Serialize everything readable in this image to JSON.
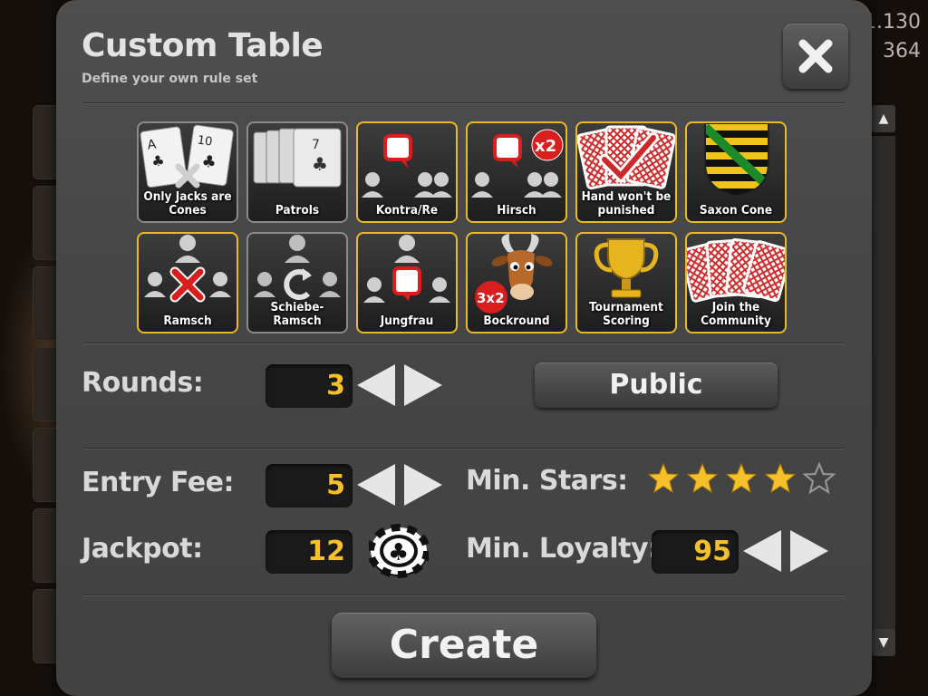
{
  "background": {
    "value_1": "1.130",
    "value_2": "364"
  },
  "dialog": {
    "title": "Custom Table",
    "subtitle": "Define your own rule set",
    "close_icon": "close-icon"
  },
  "rules": [
    {
      "label": "Only Jacks are Cones",
      "active": false,
      "icon": "jacks-cards-icon"
    },
    {
      "label": "Patrols",
      "active": false,
      "icon": "cards-fan-icon"
    },
    {
      "label": "Kontra/Re",
      "active": true,
      "icon": "kontra-players-icon"
    },
    {
      "label": "Hirsch",
      "active": true,
      "icon": "hirsch-players-icon",
      "badge": "x2"
    },
    {
      "label": "Hand won't be punished",
      "active": true,
      "icon": "check-cards-icon"
    },
    {
      "label": "Saxon Cone",
      "active": true,
      "icon": "saxony-crest-icon"
    },
    {
      "label": "Ramsch",
      "active": true,
      "icon": "ramsch-players-icon"
    },
    {
      "label": "Schiebe-Ramsch",
      "active": false,
      "icon": "schieberamsch-players-icon"
    },
    {
      "label": "Jungfrau",
      "active": true,
      "icon": "jungfrau-players-icon"
    },
    {
      "label": "Bockround",
      "active": true,
      "icon": "goat-icon",
      "badge": "3x2"
    },
    {
      "label": "Tournament Scoring",
      "active": true,
      "icon": "trophy-icon"
    },
    {
      "label": "Join the Community",
      "active": true,
      "icon": "community-cards-icon"
    }
  ],
  "settings": {
    "rounds_label": "Rounds:",
    "rounds_value": "3",
    "public_label": "Public",
    "entry_fee_label": "Entry Fee:",
    "entry_fee_value": "5",
    "min_stars_label": "Min. Stars:",
    "min_stars": 4,
    "max_stars": 5,
    "jackpot_label": "Jackpot:",
    "jackpot_value": "12",
    "min_loyalty_label": "Min. Loyalty:",
    "min_loyalty_value": "95"
  },
  "create_label": "Create",
  "colors": {
    "accent": "#f5c02a",
    "active_border": "#e8b92a",
    "dialog_bg": "#484848"
  }
}
